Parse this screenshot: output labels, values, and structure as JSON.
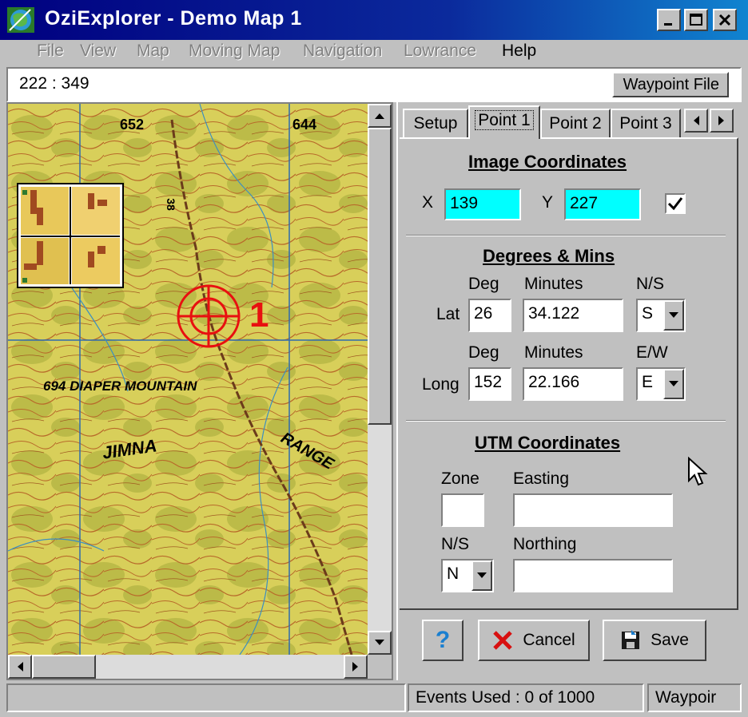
{
  "window": {
    "title": "OziExplorer - Demo Map 1",
    "accent_color": "#000080"
  },
  "menu": {
    "items": [
      {
        "label": "File",
        "enabled": false
      },
      {
        "label": "View",
        "enabled": false
      },
      {
        "label": "Map",
        "enabled": false
      },
      {
        "label": "Moving Map",
        "enabled": false
      },
      {
        "label": "Navigation",
        "enabled": false
      },
      {
        "label": "Lowrance",
        "enabled": false
      },
      {
        "label": "Help",
        "enabled": true
      }
    ]
  },
  "toolbar": {
    "coords": "222 : 349",
    "waypoint_file_button": "Waypoint File"
  },
  "map": {
    "labels": {
      "elev_652": "652",
      "elev_644": "644",
      "road_38": "38",
      "diaper_mountain": "694 DIAPER MOUNTAIN",
      "jimna": "JIMNA",
      "range": "RANGE"
    },
    "calibration_point_label": "1",
    "marker_color": "#e81010"
  },
  "tabs": [
    "Setup",
    "Point 1",
    "Point 2",
    "Point 3"
  ],
  "active_tab": "Point 1",
  "image_coords": {
    "heading": "Image Coordinates",
    "x_label": "X",
    "x_value": "139",
    "y_label": "Y",
    "y_value": "227",
    "checked": true
  },
  "deg_mins": {
    "heading": "Degrees & Mins",
    "deg_header": "Deg",
    "minutes_header": "Minutes",
    "ns_header": "N/S",
    "ew_header": "E/W",
    "lat_label": "Lat",
    "lat_deg": "26",
    "lat_min": "34.122",
    "lat_hemi": "S",
    "long_label": "Long",
    "long_deg": "152",
    "long_min": "22.166",
    "long_hemi": "E"
  },
  "utm": {
    "heading": "UTM Coordinates",
    "zone_label": "Zone",
    "zone_value": "",
    "easting_label": "Easting",
    "easting_value": "",
    "ns_label": "N/S",
    "ns_value": "N",
    "northing_label": "Northing",
    "northing_value": ""
  },
  "buttons": {
    "help": "?",
    "cancel": "Cancel",
    "save": "Save"
  },
  "status": {
    "events": "Events Used : 0 of 1000",
    "mode": "Waypoir"
  }
}
